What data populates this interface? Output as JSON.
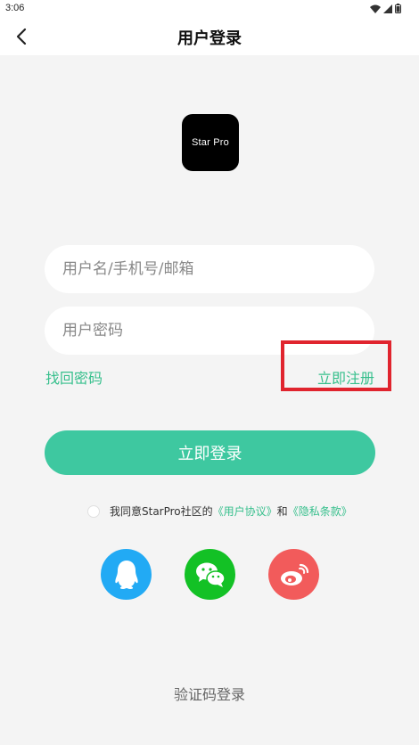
{
  "status_bar": {
    "time": "3:06"
  },
  "header": {
    "title": "用户登录"
  },
  "logo": {
    "text": "Star Pro"
  },
  "form": {
    "username_placeholder": "用户名/手机号/邮箱",
    "password_placeholder": "用户密码",
    "forgot_label": "找回密码",
    "register_label": "立即注册",
    "login_label": "立即登录"
  },
  "agreement": {
    "prefix": "我同意StarPro社区的",
    "user_agreement": "《用户协议》",
    "and": "和",
    "privacy": "《隐私条款》"
  },
  "social": [
    {
      "name": "qq-icon"
    },
    {
      "name": "wechat-icon"
    },
    {
      "name": "weibo-icon"
    }
  ],
  "footer": {
    "sms_login_label": "验证码登录"
  },
  "colors": {
    "accent": "#3ec8a0",
    "link": "#36bf8c",
    "highlight": "#e0242e"
  }
}
